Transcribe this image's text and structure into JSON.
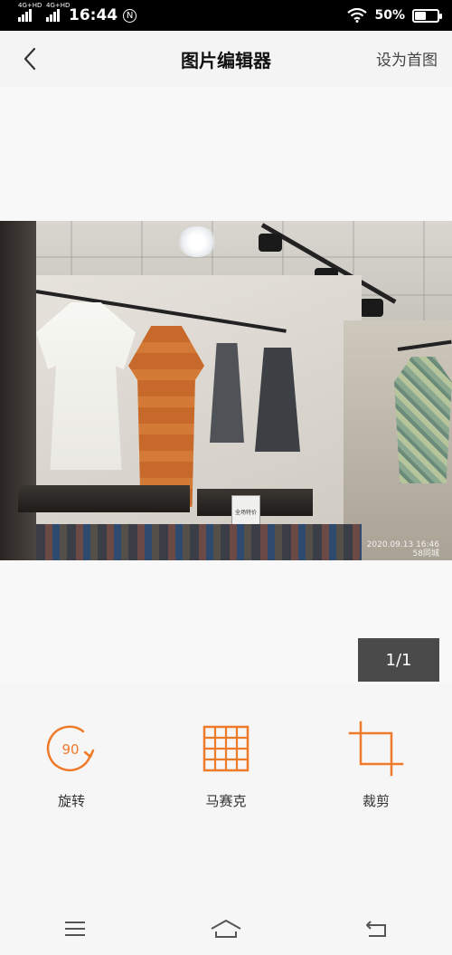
{
  "status_bar": {
    "network_1": "4G+HD",
    "network_2": "4G+HD",
    "time": "16:44",
    "nfc_icon": "NFC-badge",
    "wifi_icon": "wifi-icon",
    "battery_percent": "50%",
    "battery_level": 0.5
  },
  "app_bar": {
    "title": "图片编辑器",
    "action_label": "设为首图",
    "back_icon": "chevron-left-icon"
  },
  "photo": {
    "timestamp": "2020.09.13 16:46",
    "brand": "58同城",
    "sign_text": "全场特价"
  },
  "page_indicator": "1/1",
  "tools": [
    {
      "id": "rotate",
      "label": "旋转",
      "icon": "rotate-icon",
      "icon_text": "90"
    },
    {
      "id": "mosaic",
      "label": "马赛克",
      "icon": "mosaic-grid-icon"
    },
    {
      "id": "crop",
      "label": "裁剪",
      "icon": "crop-icon"
    }
  ],
  "nav_bar": {
    "menu_icon": "menu-icon",
    "home_icon": "home-icon",
    "back_icon": "back-icon"
  },
  "colors": {
    "accent": "#ee7a2a",
    "indicator_bg": "#4a4a4a"
  }
}
